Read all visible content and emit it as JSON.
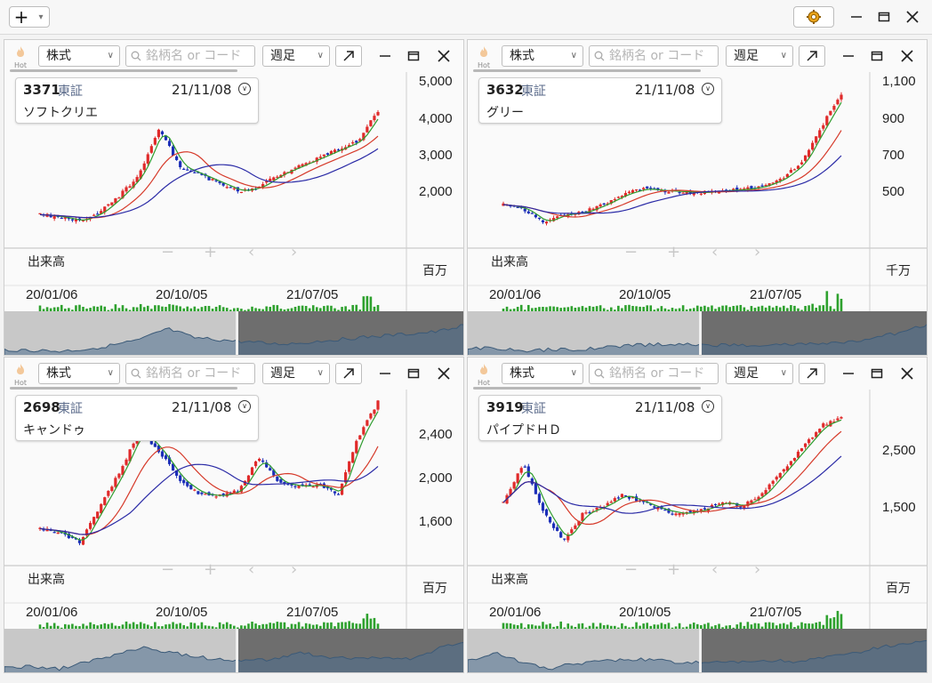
{
  "toolbar": {
    "add_label": "+",
    "chevron": "⌄",
    "settings_icon": "gear-icon"
  },
  "panels": [
    {
      "market": "株式",
      "search_placeholder": "銘柄名 or コード",
      "period": "週足",
      "hot": "Hot",
      "code": "3371",
      "exchange": "東証",
      "date": "21/11/08",
      "name": "ソフトクリエ",
      "y_ticks": [
        "5,000",
        "4,000",
        "3,000",
        "2,000"
      ],
      "x_ticks": [
        "20/01/06",
        "20/10/05",
        "21/07/05"
      ],
      "volume_label": "出来高",
      "volume_unit": "百万"
    },
    {
      "market": "株式",
      "search_placeholder": "銘柄名 or コード",
      "period": "週足",
      "hot": "Hot",
      "code": "3632",
      "exchange": "東証",
      "date": "21/11/08",
      "name": "グリー",
      "y_ticks": [
        "1,100",
        "900",
        "700",
        "500"
      ],
      "x_ticks": [
        "20/01/06",
        "20/10/05",
        "21/07/05"
      ],
      "volume_label": "出来高",
      "volume_unit": "千万"
    },
    {
      "market": "株式",
      "search_placeholder": "銘柄名 or コード",
      "period": "週足",
      "hot": "Hot",
      "code": "2698",
      "exchange": "東証",
      "date": "21/11/08",
      "name": "キャンドゥ",
      "y_ticks": [
        "2,400",
        "2,000",
        "1,600"
      ],
      "x_ticks": [
        "20/01/06",
        "20/10/05",
        "21/07/05"
      ],
      "volume_label": "出来高",
      "volume_unit": "百万"
    },
    {
      "market": "株式",
      "search_placeholder": "銘柄名 or コード",
      "period": "週足",
      "hot": "Hot",
      "code": "3919",
      "exchange": "東証",
      "date": "21/11/08",
      "name": "パイプドＨＤ",
      "y_ticks": [
        "2,500",
        "1,500"
      ],
      "x_ticks": [
        "20/01/06",
        "20/10/05",
        "21/07/05"
      ],
      "volume_label": "出来高",
      "volume_unit": "百万"
    }
  ],
  "chart_data": [
    {
      "type": "line",
      "title": "3371 ソフトクリエ",
      "x": [
        "20/01/06",
        "20/10/05",
        "21/07/05"
      ],
      "ylim": [
        1000,
        5000
      ],
      "series": [
        {
          "values": [
            1750,
            1700,
            1600,
            1800,
            2200,
            2700,
            3800,
            2900,
            2700,
            2500,
            2300,
            2400,
            2700,
            2900,
            3100,
            3300,
            3500,
            4200
          ]
        }
      ]
    },
    {
      "type": "line",
      "title": "3632 グリー",
      "x": [
        "20/01/06",
        "20/10/05",
        "21/07/05"
      ],
      "ylim": [
        300,
        1150
      ],
      "series": [
        {
          "values": [
            510,
            490,
            420,
            460,
            470,
            510,
            560,
            590,
            580,
            575,
            570,
            580,
            585,
            600,
            640,
            720,
            900,
            1070
          ]
        }
      ]
    },
    {
      "type": "line",
      "title": "2698 キャンドゥ",
      "x": [
        "20/01/06",
        "20/10/05",
        "21/07/05"
      ],
      "ylim": [
        1400,
        2600
      ],
      "series": [
        {
          "values": [
            1650,
            1620,
            1550,
            1800,
            2050,
            2350,
            2200,
            2000,
            1900,
            1880,
            1920,
            2150,
            1980,
            1950,
            1960,
            1900,
            2300,
            2550
          ]
        }
      ]
    },
    {
      "type": "line",
      "title": "3919 パイプドＨＤ",
      "x": [
        "20/01/06",
        "20/10/05",
        "21/07/05"
      ],
      "ylim": [
        1000,
        3200
      ],
      "series": [
        {
          "values": [
            1800,
            2300,
            1700,
            1300,
            1650,
            1750,
            1900,
            1800,
            1700,
            1650,
            1700,
            1800,
            1750,
            1900,
            2200,
            2500,
            2800,
            2900
          ]
        }
      ]
    }
  ]
}
